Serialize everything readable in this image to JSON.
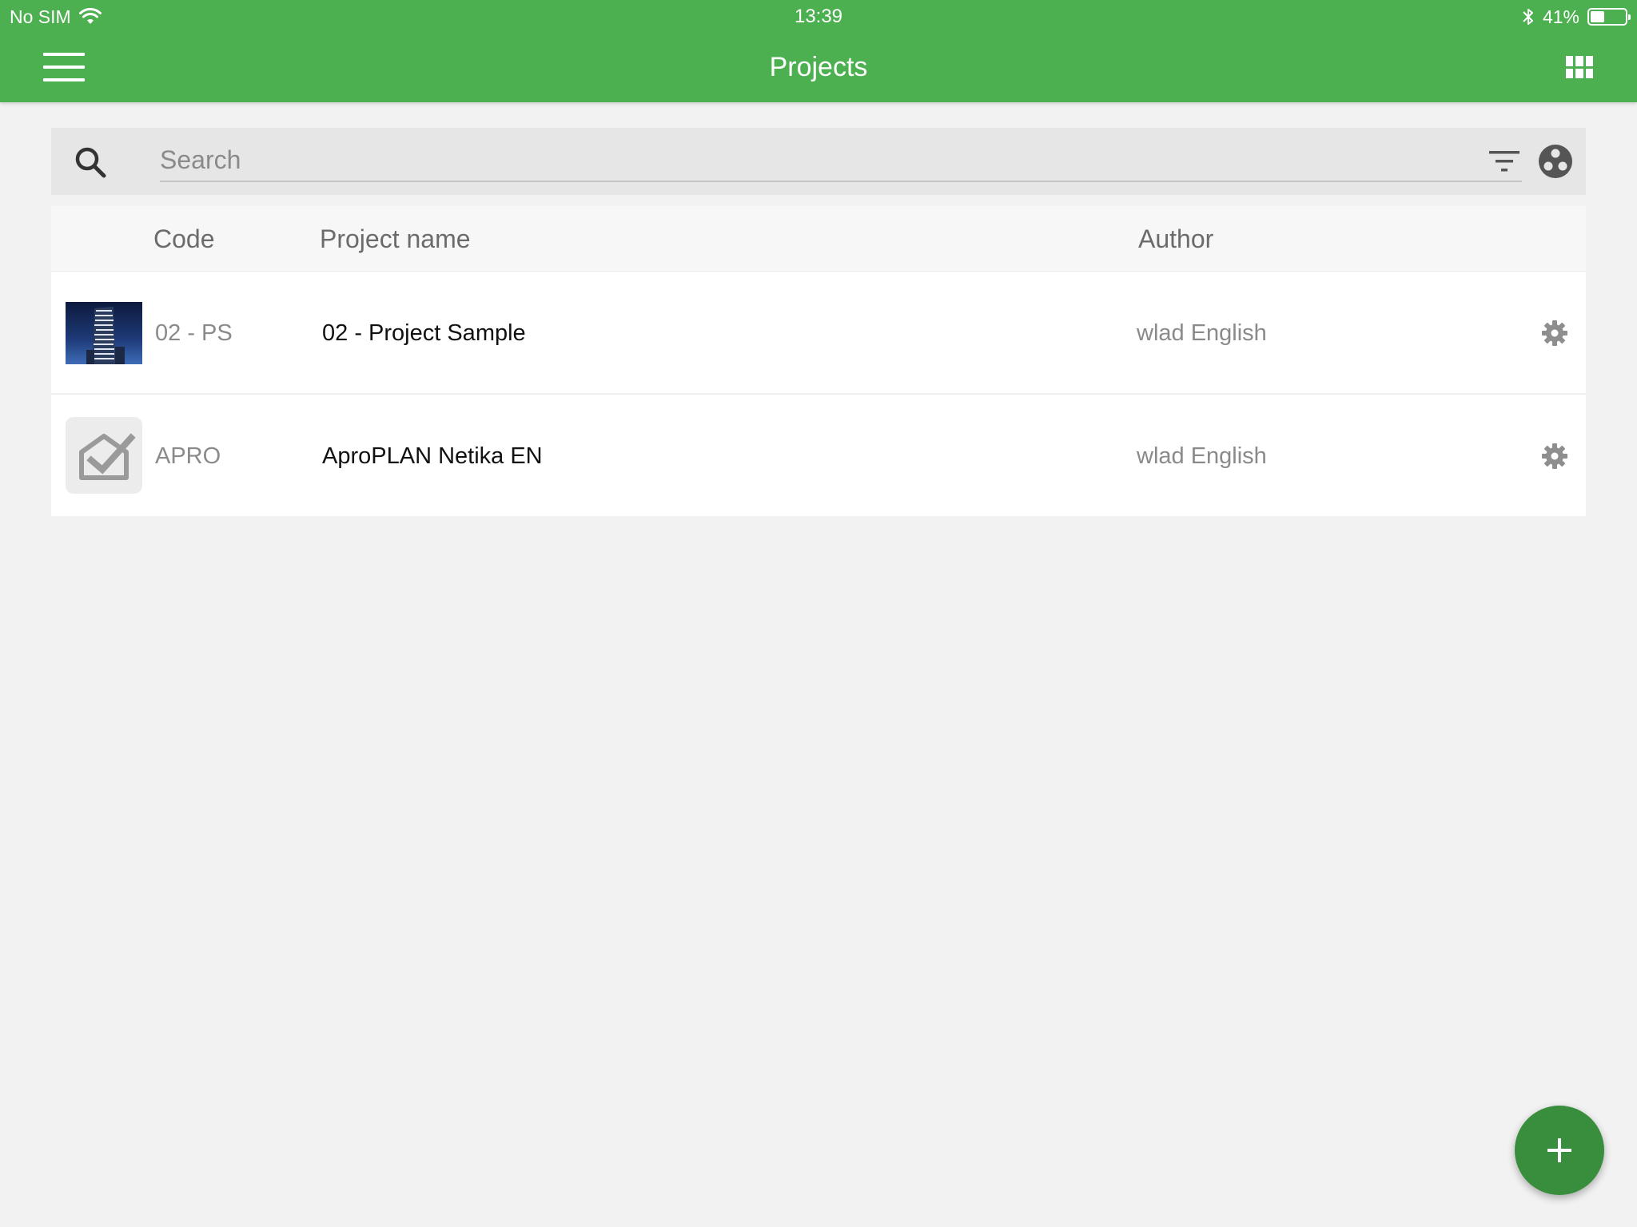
{
  "status_bar": {
    "carrier": "No SIM",
    "time": "13:39",
    "battery_percent": "41%",
    "battery_level": 0.41
  },
  "app_bar": {
    "title": "Projects",
    "menu_icon": "hamburger-menu-icon",
    "view_toggle_icon": "grid-view-icon"
  },
  "search": {
    "placeholder": "Search",
    "value": "",
    "filter_icon": "filter-icon",
    "share_icon": "share-icon"
  },
  "table": {
    "columns": {
      "code": "Code",
      "project_name": "Project name",
      "author": "Author"
    },
    "rows": [
      {
        "code": "02 - PS",
        "name": "02 - Project Sample",
        "author": "wlad English",
        "thumbnail": "building-photo"
      },
      {
        "code": "APRO",
        "name": "AproPLAN Netika EN",
        "author": "wlad English",
        "thumbnail": "aproplan-logo"
      }
    ]
  },
  "fab": {
    "icon": "plus-icon"
  },
  "colors": {
    "primary": "#4caf50",
    "fab": "#388e3c",
    "background": "#f2f2f2"
  }
}
